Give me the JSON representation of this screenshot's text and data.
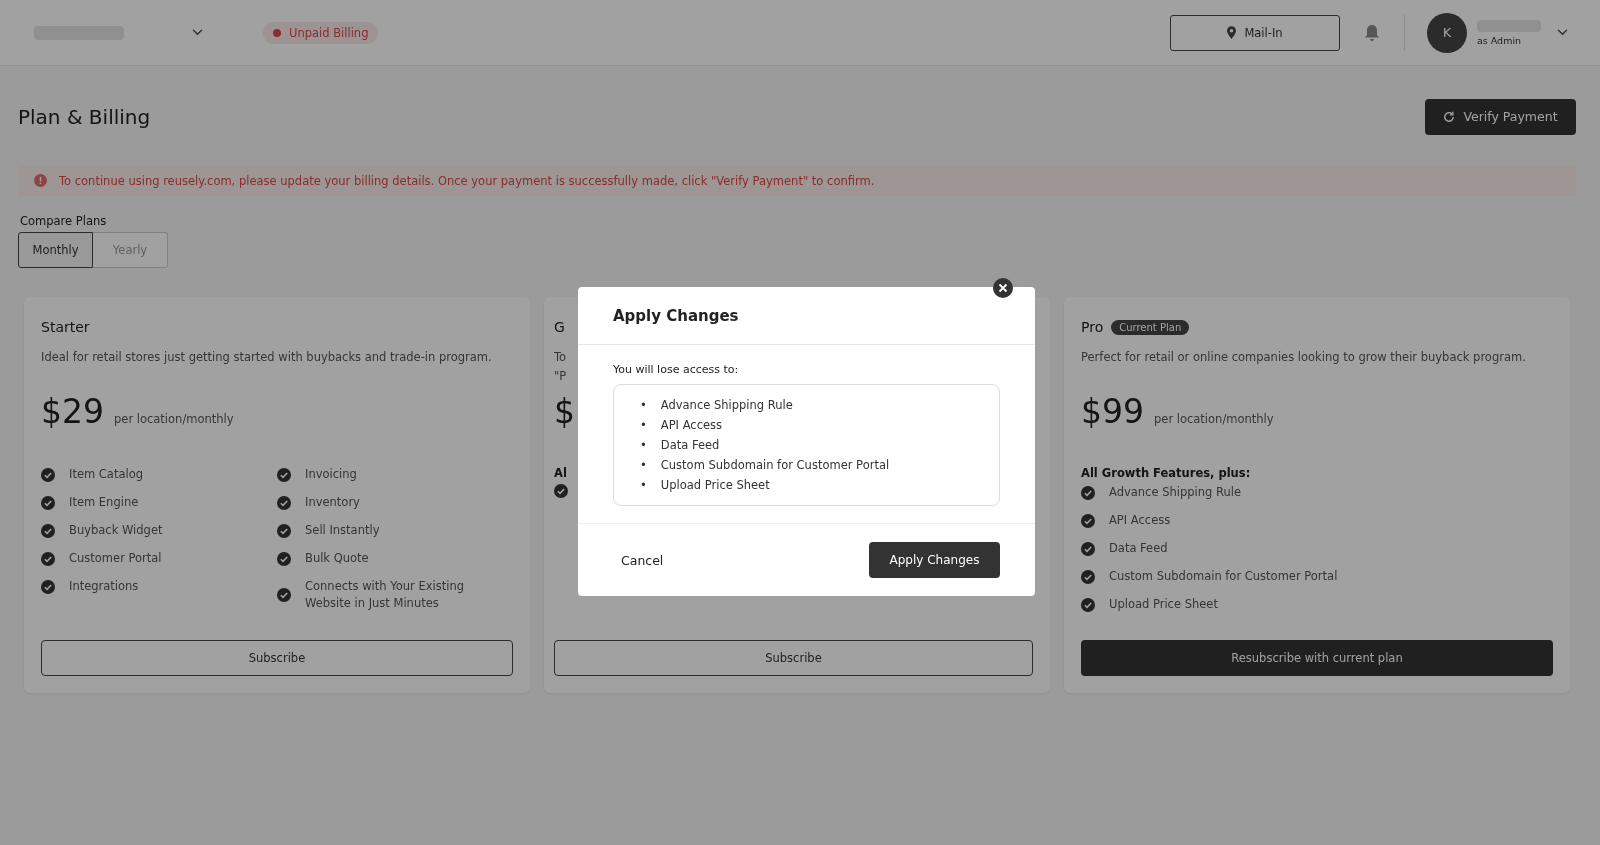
{
  "top_bar": {
    "status_badge": "Unpaid Billing",
    "location_button": "Mail-In",
    "user": {
      "initial": "K",
      "role": "as Admin"
    }
  },
  "page": {
    "title": "Plan & Billing",
    "verify_button": "Verify Payment",
    "alert": "To continue using reusely.com, please update your billing details. Once your payment is successfully made, click \"Verify Payment\" to confirm.",
    "compare_label": "Compare Plans",
    "billing_periods": [
      {
        "label": "Monthly",
        "selected": true
      },
      {
        "label": "Yearly",
        "selected": false
      }
    ]
  },
  "plans": [
    {
      "name": "Starter",
      "description_lines": [
        "Ideal for retail stores just getting started with buybacks and trade-in program."
      ],
      "price": "$29",
      "unit": "per location/monthly",
      "feature_columns": [
        [
          {
            "label": "Item Catalog",
            "checked": true
          },
          {
            "label": "Item Engine",
            "checked": true
          },
          {
            "label": "Buyback Widget",
            "checked": true
          },
          {
            "label": "Customer Portal",
            "checked": true
          },
          {
            "label": "Integrations",
            "checked": true
          }
        ],
        [
          {
            "label": "Invoicing",
            "checked": true
          },
          {
            "label": "Inventory",
            "checked": true
          },
          {
            "label": "Sell Instantly",
            "checked": true
          },
          {
            "label": "Bulk Quote",
            "checked": true
          },
          {
            "label": "Connects with Your Existing Website in Just Minutes",
            "checked": true
          }
        ]
      ],
      "button": {
        "label": "Subscribe",
        "kind": "outline"
      }
    },
    {
      "name": "G",
      "description_lines": [
        "To",
        "\"P"
      ],
      "price": "$",
      "features_heading": "Al",
      "feature_columns": [
        [
          {
            "checked": true
          }
        ]
      ],
      "button": {
        "label": "Subscribe",
        "kind": "outline"
      }
    },
    {
      "name": "Pro",
      "badge": "Current Plan",
      "description_lines": [
        "Perfect for retail or online companies looking to grow their buyback program."
      ],
      "price": "$99",
      "unit": "per location/monthly",
      "features_heading": "All Growth Features, plus:",
      "feature_columns": [
        [
          {
            "label": "Advance Shipping Rule",
            "checked": true
          },
          {
            "label": "API Access",
            "checked": true
          },
          {
            "label": "Data Feed",
            "checked": true
          },
          {
            "label": "Custom Subdomain for Customer Portal",
            "checked": true
          },
          {
            "label": "Upload Price Sheet",
            "checked": true
          }
        ]
      ],
      "button": {
        "label": "Resubscribe with current plan",
        "kind": "primary"
      }
    }
  ],
  "modal": {
    "title": "Apply Changes",
    "bullet": "•",
    "intro": "You will lose access to:",
    "items": [
      "Advance Shipping Rule",
      "API Access",
      "Data Feed",
      "Custom Subdomain for Customer Portal",
      "Upload Price Sheet"
    ],
    "cancel_button": "Cancel",
    "confirm_button": "Apply Changes"
  }
}
